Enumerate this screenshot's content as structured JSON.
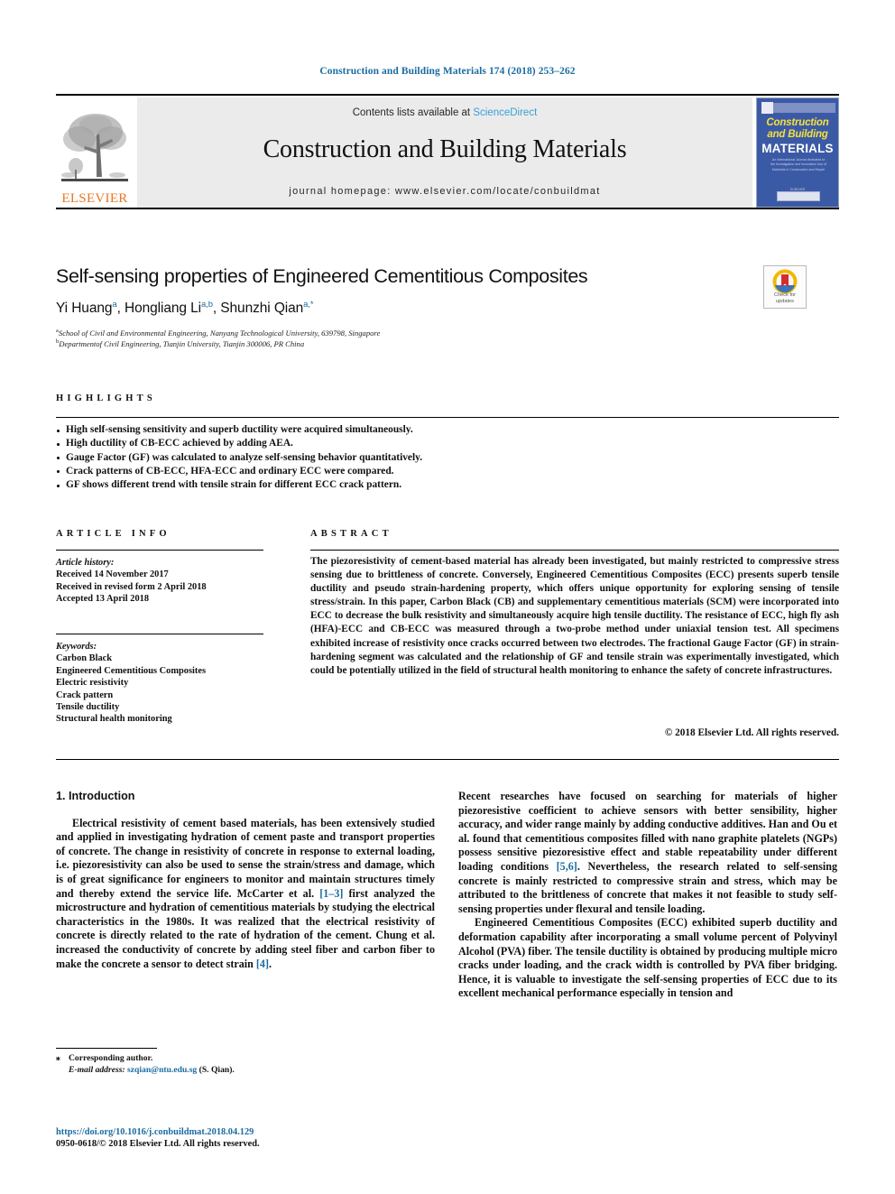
{
  "running_head": "Construction and Building Materials 174 (2018) 253–262",
  "masthead": {
    "publisher_logo_label": "ELSEVIER",
    "contents_prefix": "Contents lists available at ",
    "contents_link": "ScienceDirect",
    "journal_title": "Construction and Building Materials",
    "homepage": "journal homepage: www.elsevier.com/locate/conbuildmat",
    "cover": {
      "line1": "Construction",
      "line2": "and Building",
      "line3": "MATERIALS",
      "blurb": "An International Journal dedicated to the Investigation and Innovative Use of Materials in Construction and Repair",
      "footer_label": "ELSEVIER"
    }
  },
  "crossmark": {
    "line1": "Check for",
    "line2": "updates"
  },
  "article": {
    "title": "Self-sensing properties of Engineered Cementitious Composites",
    "authors_html": "Yi Huang<sup>a</sup>, Hongliang Li<sup>a,b</sup>, Shunzhi Qian<sup>a,*</sup>",
    "affiliation_a": "School of Civil and Environmental Engineering, Nanyang Technological University, 639798, Singapore",
    "affiliation_b": "Departmentof Civil Engineering, Tianjin University, Tianjin 300006, PR China"
  },
  "highlights": {
    "label": "HIGHLIGHTS",
    "items": [
      "High self-sensing sensitivity and superb ductility were acquired simultaneously.",
      "High ductility of CB-ECC achieved by adding AEA.",
      "Gauge Factor (GF) was calculated to analyze self-sensing behavior quantitatively.",
      "Crack patterns of CB-ECC, HFA-ECC and ordinary ECC were compared.",
      "GF shows different trend with tensile strain for different ECC crack pattern."
    ]
  },
  "article_info": {
    "label": "ARTICLE INFO",
    "history_label": "Article history:",
    "history": [
      "Received 14 November 2017",
      "Received in revised form 2 April 2018",
      "Accepted 13 April 2018"
    ],
    "keywords_label": "Keywords:",
    "keywords": [
      "Carbon Black",
      "Engineered Cementitious Composites",
      "Electric resistivity",
      "Crack pattern",
      "Tensile ductility",
      "Structural health monitoring"
    ]
  },
  "abstract": {
    "label": "ABSTRACT",
    "text": "The piezoresistivity of cement-based material has already been investigated, but mainly restricted to compressive stress sensing due to brittleness of concrete. Conversely, Engineered Cementitious Composites (ECC) presents superb tensile ductility and pseudo strain-hardening property, which offers unique opportunity for exploring sensing of tensile stress/strain. In this paper, Carbon Black (CB) and supplementary cementitious materials (SCM) were incorporated into ECC to decrease the bulk resistivity and simultaneously acquire high tensile ductility. The resistance of ECC, high fly ash (HFA)-ECC and CB-ECC was measured through a two-probe method under uniaxial tension test. All specimens exhibited increase of resistivity once cracks occurred between two electrodes. The fractional Gauge Factor (GF) in strain-hardening segment was calculated and the relationship of GF and tensile strain was experimentally investigated, which could be potentially utilized in the field of structural health monitoring to enhance the safety of concrete infrastructures.",
    "copyright": "© 2018 Elsevier Ltd. All rights reserved."
  },
  "body": {
    "section_heading": "1. Introduction",
    "left_paragraph_1_a": "Electrical resistivity of cement based materials, has been extensively studied and applied in investigating hydration of cement paste and transport properties of concrete. The change in resistivity of concrete in response to external loading, i.e. piezoresistivity can also be used to sense the strain/stress and damage, which is of great significance for engineers to monitor and maintain structures timely and thereby extend the service life. McCarter et al. ",
    "ref_1_3": "[1–3]",
    "left_paragraph_1_b": " first analyzed the microstructure and hydration of cementitious materials by studying the electrical characteristics in the 1980s. It was realized that the electrical resistivity of concrete is directly related to the rate of hydration of the cement. Chung et al. increased the conductivity of concrete by adding steel fiber and carbon fiber to make the concrete a sensor to detect strain ",
    "ref_4": "[4]",
    "left_paragraph_1_c": ".",
    "right_paragraph_1_a": "Recent researches have focused on searching for materials of higher piezoresistive coefficient to achieve sensors with better sensibility, higher accuracy, and wider range mainly by adding conductive additives. Han and Ou et al. found that cementitious composites filled with nano graphite platelets (NGPs) possess sensitive piezoresistive effect and stable repeatability under different loading conditions ",
    "ref_5_6": "[5,6]",
    "right_paragraph_1_b": ". Nevertheless, the research related to self-sensing concrete is mainly restricted to compressive strain and stress, which may be attributed to the brittleness of concrete that makes it not feasible to study self-sensing properties under flexural and tensile loading.",
    "right_paragraph_2": "Engineered Cementitious Composites (ECC) exhibited superb ductility and deformation capability after incorporating a small volume percent of Polyvinyl Alcohol (PVA) fiber. The tensile ductility is obtained by producing multiple micro cracks under loading, and the crack width is controlled by PVA fiber bridging. Hence, it is valuable to investigate the self-sensing properties of ECC due to its excellent mechanical performance especially in tension and"
  },
  "footer": {
    "corresponding_marker": "⁎",
    "corresponding_label": "Corresponding author.",
    "email_label": "E-mail address:",
    "email": "szqian@ntu.edu.sg",
    "email_owner": "(S. Qian).",
    "doi": "https://doi.org/10.1016/j.conbuildmat.2018.04.129",
    "issn": "0950-0618/© 2018 Elsevier Ltd. All rights reserved."
  },
  "colors": {
    "link_blue": "#1b6ca1",
    "sciencedirect_blue": "#3a9fd6",
    "elsevier_orange": "#e87722",
    "cover_blue": "#3b5aa6",
    "cover_yellow": "#f5e03c"
  }
}
